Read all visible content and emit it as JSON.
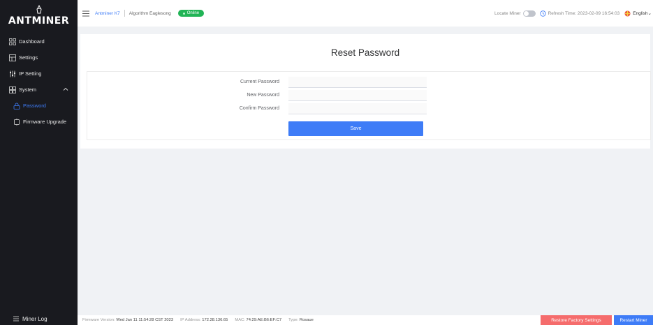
{
  "brand": {
    "logo_text": "ANTMINER"
  },
  "sidebar": {
    "items": [
      {
        "label": "Dashboard",
        "icon": "dashboard-icon"
      },
      {
        "label": "Settings",
        "icon": "settings-icon"
      },
      {
        "label": "IP Setting",
        "icon": "ip-setting-icon"
      },
      {
        "label": "System",
        "icon": "system-icon"
      },
      {
        "label": "Password",
        "icon": "lock-icon"
      },
      {
        "label": "Firmware Upgrade",
        "icon": "firmware-icon"
      }
    ],
    "footer_label": "Miner Log"
  },
  "header": {
    "model": "Antminer K7",
    "algorithm": "Algorithm Eaglesong",
    "status": "Online",
    "locate_label": "Locate Miner",
    "refresh_label": "Refresh Time: 2023-02-09 16:54:03",
    "language": "English"
  },
  "main": {
    "title": "Reset Password",
    "fields": {
      "current_label": "Current Password",
      "new_label": "New Password",
      "confirm_label": "Confirm Password"
    },
    "save_label": "Save"
  },
  "footer": {
    "firmware_label": "Firmware Version:",
    "firmware_value": "Wed Jan 11 11:54:28 CST 2023",
    "ip_label": "IP Address:",
    "ip_value": "172.28.136.65",
    "mac_label": "MAC:",
    "mac_value": "74:29:AE:B6:EF:C7",
    "type_label": "Type:",
    "type_value": "Rosaue",
    "restore_label": "Restore Factory Settings",
    "restart_label": "Restart Miner"
  },
  "colors": {
    "sidebar_bg": "#191a1f",
    "accent": "#3e7cf7",
    "online": "#21b456",
    "danger": "#f56c6c"
  }
}
